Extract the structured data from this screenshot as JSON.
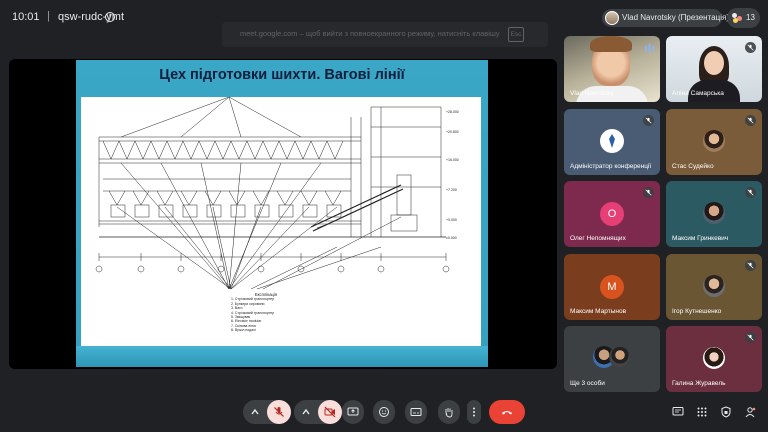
{
  "meeting": {
    "time": "10:01",
    "separator": "|",
    "code": "qsw-rudc-ymt"
  },
  "toast": {
    "text": "meet.google.com – щоб вийти з повноекранного режиму, натисніть клавішу",
    "key": "Esc"
  },
  "presenter": {
    "label": "Vlad Navrotsky (Презентація)"
  },
  "people": {
    "count": "13",
    "dot_colors": [
      "#e8eaed",
      "#f28b82",
      "#fdd663"
    ]
  },
  "slide": {
    "title": "Цех підготовки шихти. Вагові лінії",
    "bg_color": "#3aa7c7",
    "title_color": "#0f1e3c",
    "legend_title": "Експлікація",
    "legend_items": [
      "1. Стрічковий транспортер",
      "2. Бункери сировини",
      "3. Ваги",
      "4. Стрічковий транспортер",
      "5. Змішувач",
      "6. Elevator modular",
      "7. Скіпова лінія",
      "8. Вузол подачі"
    ]
  },
  "participants": [
    {
      "name": "Vlad Navrotsky",
      "type": "video",
      "muted": false,
      "presenting": true
    },
    {
      "name": "Аліна Самарська",
      "type": "video",
      "muted": true
    },
    {
      "name": "Адміністратор конференції",
      "type": "avatar-logo",
      "muted": true,
      "bg": "#4a5c73"
    },
    {
      "name": "Стас Судейко",
      "type": "photo",
      "muted": true,
      "bg": "#7a5b3a"
    },
    {
      "name": "Олег Непомнящих",
      "type": "letter",
      "letter": "O",
      "muted": true,
      "bg": "#7e2a4e",
      "circle": "#e53f75"
    },
    {
      "name": "Максим Гринкевич",
      "type": "photo",
      "muted": true,
      "bg": "#2c5a62"
    },
    {
      "name": "Максим Мартынов",
      "type": "letter",
      "letter": "M",
      "muted": false,
      "bg": "#7a3d1e",
      "circle": "#d9531f"
    },
    {
      "name": "Ігор Кутнешенко",
      "type": "photo",
      "muted": true,
      "bg": "#6b5634"
    },
    {
      "name": "Ще 3 особи",
      "type": "group",
      "muted": false,
      "bg": "#3c4043"
    },
    {
      "name": "Галина Журавель",
      "type": "photo",
      "muted": true,
      "bg": "#6b2f3f"
    }
  ],
  "toolbar": {
    "mic_state": "off",
    "camera_state": "off",
    "buttons": [
      "mic-options",
      "mic-toggle",
      "camera-options",
      "camera-toggle",
      "present",
      "reactions",
      "captions",
      "raise-hand",
      "more-options",
      "leave-call"
    ],
    "right_icons": [
      "chat",
      "activities",
      "host-controls",
      "more-people"
    ],
    "leave_color": "#ea4335",
    "muted_color": "#f9dedc"
  }
}
